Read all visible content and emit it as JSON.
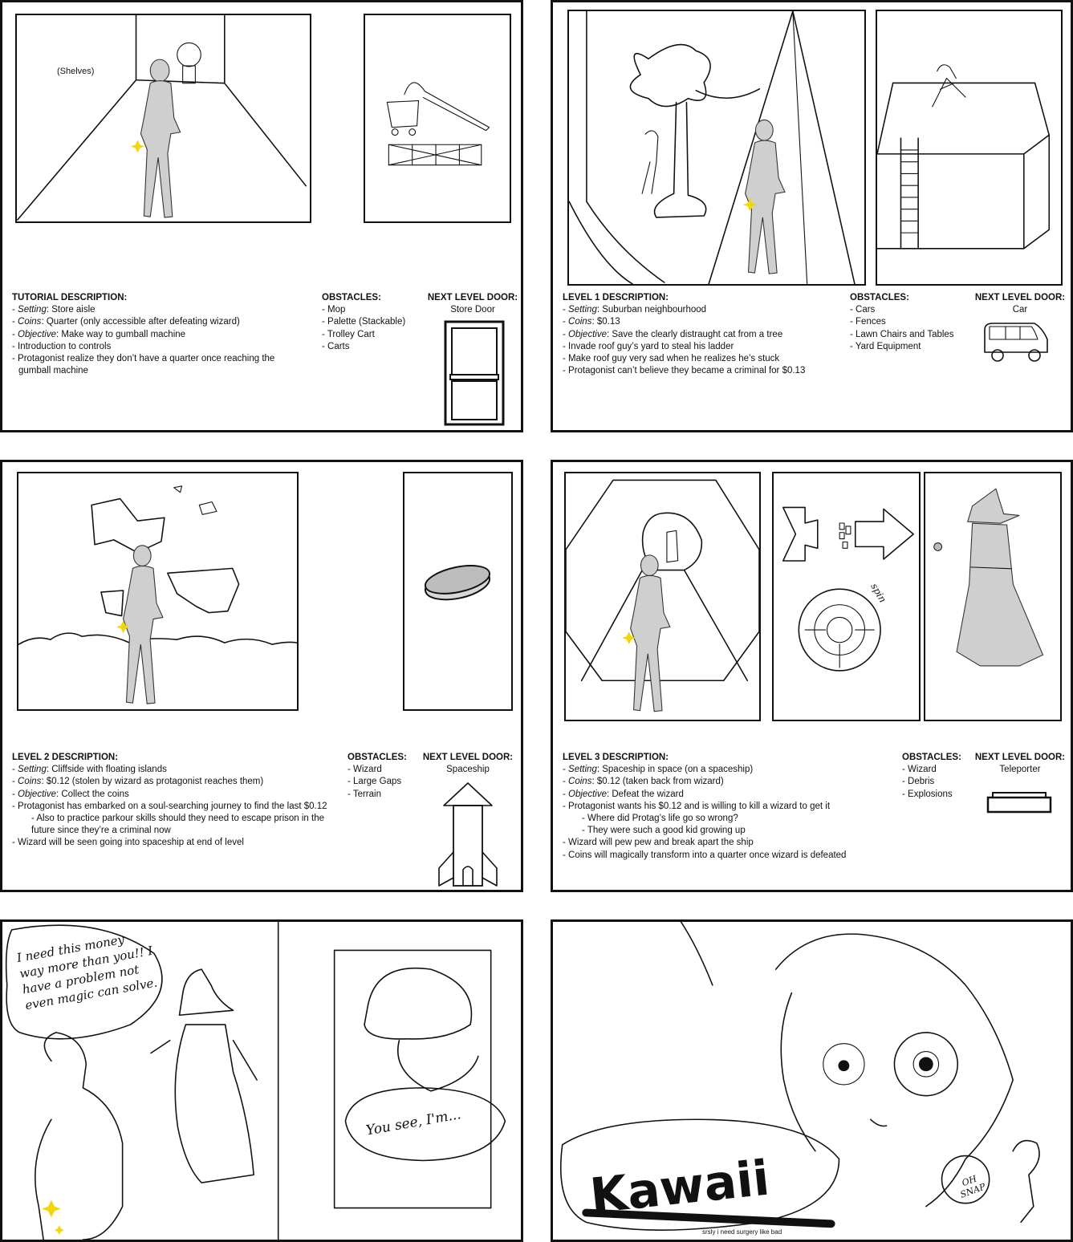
{
  "tutorial": {
    "label_shelves": "(Shelves)",
    "title": "TUTORIAL DESCRIPTION:",
    "lines": [
      {
        "key": "Setting",
        "text": ": Store aisle"
      },
      {
        "key": "Coins",
        "text": ": Quarter (only accessible after defeating wizard)"
      },
      {
        "key": "Objective",
        "text": ": Make way to gumball machine"
      },
      {
        "key": "",
        "text": "- Introduction to controls"
      },
      {
        "key": "",
        "text": "- Protagonist realize they don’t have a quarter once reaching the"
      },
      {
        "key": "",
        "text": "gumball machine"
      }
    ],
    "obstacles_title": "OBSTACLES:",
    "obstacles": [
      "- Mop",
      "- Palette (Stackable)",
      "- Trolley Cart",
      "- Carts"
    ],
    "door_title": "NEXT LEVEL DOOR:",
    "door_name": "Store Door"
  },
  "level1": {
    "title": "LEVEL 1 DESCRIPTION:",
    "lines": [
      {
        "key": "Setting",
        "text": ": Suburban neighbourhood"
      },
      {
        "key": "Coins",
        "text": ": $0.13"
      },
      {
        "key": "Objective",
        "text": ": Save the clearly distraught cat from a tree"
      },
      {
        "key": "",
        "text": "- Invade roof guy’s yard to steal his ladder"
      },
      {
        "key": "",
        "text": "- Make roof guy very sad when he realizes he’s stuck"
      },
      {
        "key": "",
        "text": "- Protagonist can’t believe they became a criminal for $0.13"
      }
    ],
    "obstacles_title": "OBSTACLES:",
    "obstacles": [
      "- Cars",
      "- Fences",
      "- Lawn Chairs and Tables",
      "- Yard Equipment"
    ],
    "door_title": "NEXT LEVEL DOOR:",
    "door_name": "Car"
  },
  "level2": {
    "title": "LEVEL 2 DESCRIPTION:",
    "lines": [
      {
        "key": "Setting",
        "text": ": Cliffside with floating islands"
      },
      {
        "key": "Coins",
        "text": ": $0.12 (stolen by wizard as protagonist reaches them)"
      },
      {
        "key": "Objective",
        "text": ": Collect the coins"
      },
      {
        "key": "",
        "text": "- Protagonist has embarked on a soul-searching journey to find the last $0.12"
      },
      {
        "key": "",
        "text": "- Also to practice parkour skills should they need to escape prison in the"
      },
      {
        "key": "",
        "text": "future since they’re a criminal now"
      },
      {
        "key": "",
        "text": "- Wizard will be seen going  into spaceship at end of level"
      }
    ],
    "obstacles_title": "OBSTACLES:",
    "obstacles": [
      "- Wizard",
      "- Large Gaps",
      "- Terrain"
    ],
    "door_title": "NEXT LEVEL DOOR:",
    "door_name": "Spaceship"
  },
  "level3": {
    "title": "LEVEL 3 DESCRIPTION:",
    "spin_label": "spin",
    "lines": [
      {
        "key": "Setting",
        "text": ": Spaceship in space (on a spaceship)"
      },
      {
        "key": "Coins",
        "text": ": $0.12 (taken back from wizard)"
      },
      {
        "key": "Objective",
        "text": ": Defeat the wizard"
      },
      {
        "key": "",
        "text": "- Protagonist wants his $0.12 and is willing to kill a wizard to get it"
      },
      {
        "key": "",
        "text": "- Where did Protag’s life go so wrong?"
      },
      {
        "key": "",
        "text": "- They were such a good kid growing up"
      },
      {
        "key": "",
        "text": "- Wizard will pew pew and break apart the ship"
      },
      {
        "key": "",
        "text": "- Coins will magically transform into a quarter once wizard is defeated"
      }
    ],
    "obstacles_title": "OBSTACLES:",
    "obstacles": [
      "- Wizard",
      "- Debris",
      "- Explosions"
    ],
    "door_title": "NEXT LEVEL DOOR:",
    "door_name": "Teleporter"
  },
  "comic": {
    "speech_1": "I need this money way more than you!! I have a problem not even magic can solve.",
    "speech_2": "You see, I'm...",
    "kawaii": "Kawaii",
    "oh_snap": "OH SNAP",
    "caption": "srsly i need surgery like bad"
  },
  "colors": {
    "ink": "#111111",
    "figure": "#cfcfcf",
    "sparkle": "#f2d60a"
  }
}
